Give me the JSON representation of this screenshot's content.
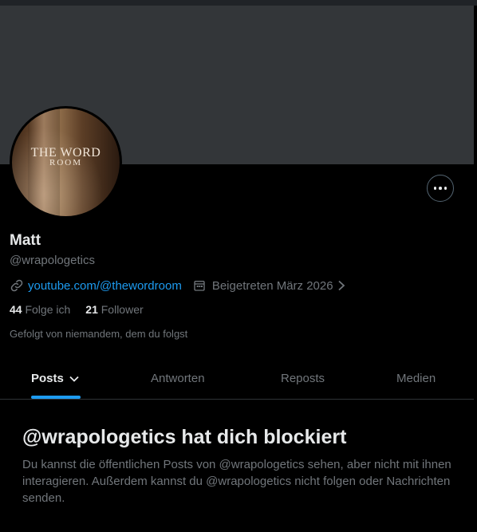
{
  "profile": {
    "name": "Matt",
    "handle": "@wrapologetics",
    "avatar_text_line1": "THE WORD",
    "avatar_text_line2": "ROOM",
    "website": "youtube.com/@thewordroom",
    "joined": "Beigetreten März 2026",
    "following_count": "44",
    "following_label": "Folge ich",
    "followers_count": "21",
    "followers_label": "Follower",
    "followed_by": "Gefolgt von niemandem, dem du folgst"
  },
  "tabs": [
    {
      "label": "Posts",
      "active": true
    },
    {
      "label": "Antworten",
      "active": false
    },
    {
      "label": "Reposts",
      "active": false
    },
    {
      "label": "Medien",
      "active": false
    }
  ],
  "blocked": {
    "title": "@wrapologetics hat dich blockiert",
    "description": "Du kannst die öffentlichen Posts von @wrapologetics sehen, aber nicht mit ihnen interagieren. Außerdem kannst du @wrapologetics nicht folgen oder Nachrichten senden."
  },
  "icons": {
    "more": "more-horizontal-icon",
    "link": "link-icon",
    "calendar": "calendar-icon",
    "chevron": "chevron-right-icon",
    "tab_dropdown": "chevron-down-icon"
  },
  "colors": {
    "background": "#000000",
    "banner": "#333639",
    "accent": "#1d9bf0",
    "text_primary": "#e7e9ea",
    "text_secondary": "#71767b",
    "border": "#2f3336"
  }
}
